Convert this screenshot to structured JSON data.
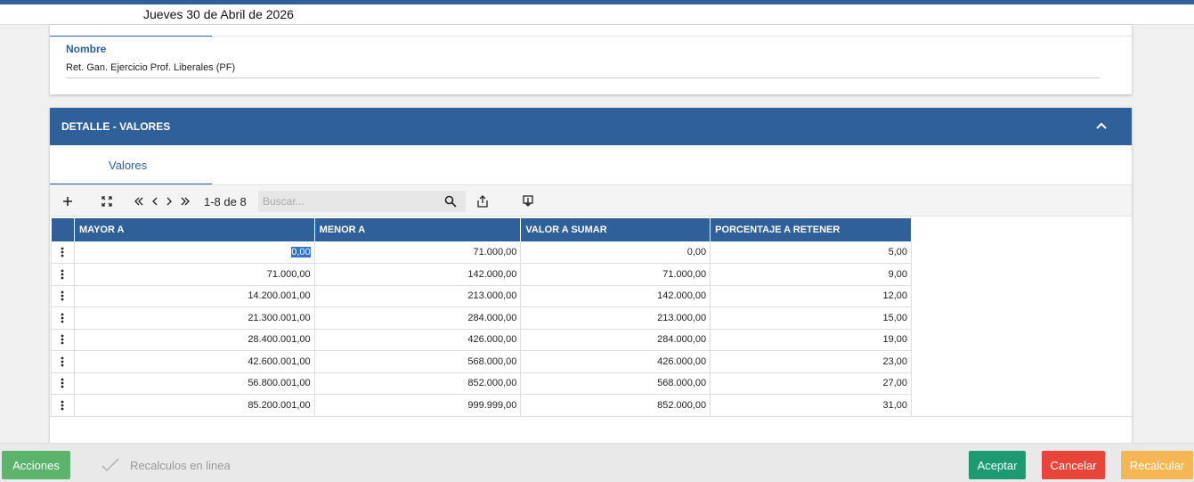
{
  "header": {
    "date": "Jueves 30 de Abril de 2026"
  },
  "general": {
    "name_label": "Nombre",
    "name_value": "Ret. Gan. Ejercicio Prof. Liberales (PF)"
  },
  "detail": {
    "title": "DETALLE - VALORES",
    "tab_label": "Valores",
    "toolbar": {
      "page_label": "1-8 de 8",
      "search_placeholder": "Buscar..."
    },
    "columns": [
      "MAYOR A",
      "MENOR A",
      "VALOR A SUMAR",
      "PORCENTAJE A RETENER"
    ],
    "rows": [
      [
        "0,00",
        "71.000,00",
        "0,00",
        "5,00"
      ],
      [
        "71.000,00",
        "142.000,00",
        "71.000,00",
        "9,00"
      ],
      [
        "14.200.001,00",
        "213.000,00",
        "142.000,00",
        "12,00"
      ],
      [
        "21.300.001,00",
        "284.000,00",
        "213.000,00",
        "15,00"
      ],
      [
        "28.400.001,00",
        "426.000,00",
        "284.000,00",
        "19,00"
      ],
      [
        "42.600.001,00",
        "568.000,00",
        "426.000,00",
        "23,00"
      ],
      [
        "56.800.001,00",
        "852.000,00",
        "568.000,00",
        "27,00"
      ],
      [
        "85.200.001,00",
        "999.999,00",
        "852.000,00",
        "31,00"
      ]
    ]
  },
  "footer": {
    "acciones": "Acciones",
    "recalc_inline": "Recalculos en linea",
    "aceptar": "Aceptar",
    "cancelar": "Cancelar",
    "recalcular": "Recalcular"
  },
  "colors": {
    "primary": "#2f6099",
    "acciones": "#5cb36b",
    "aceptar": "#1e9a73",
    "cancelar": "#e8443a",
    "recalcular": "#f7b654"
  }
}
